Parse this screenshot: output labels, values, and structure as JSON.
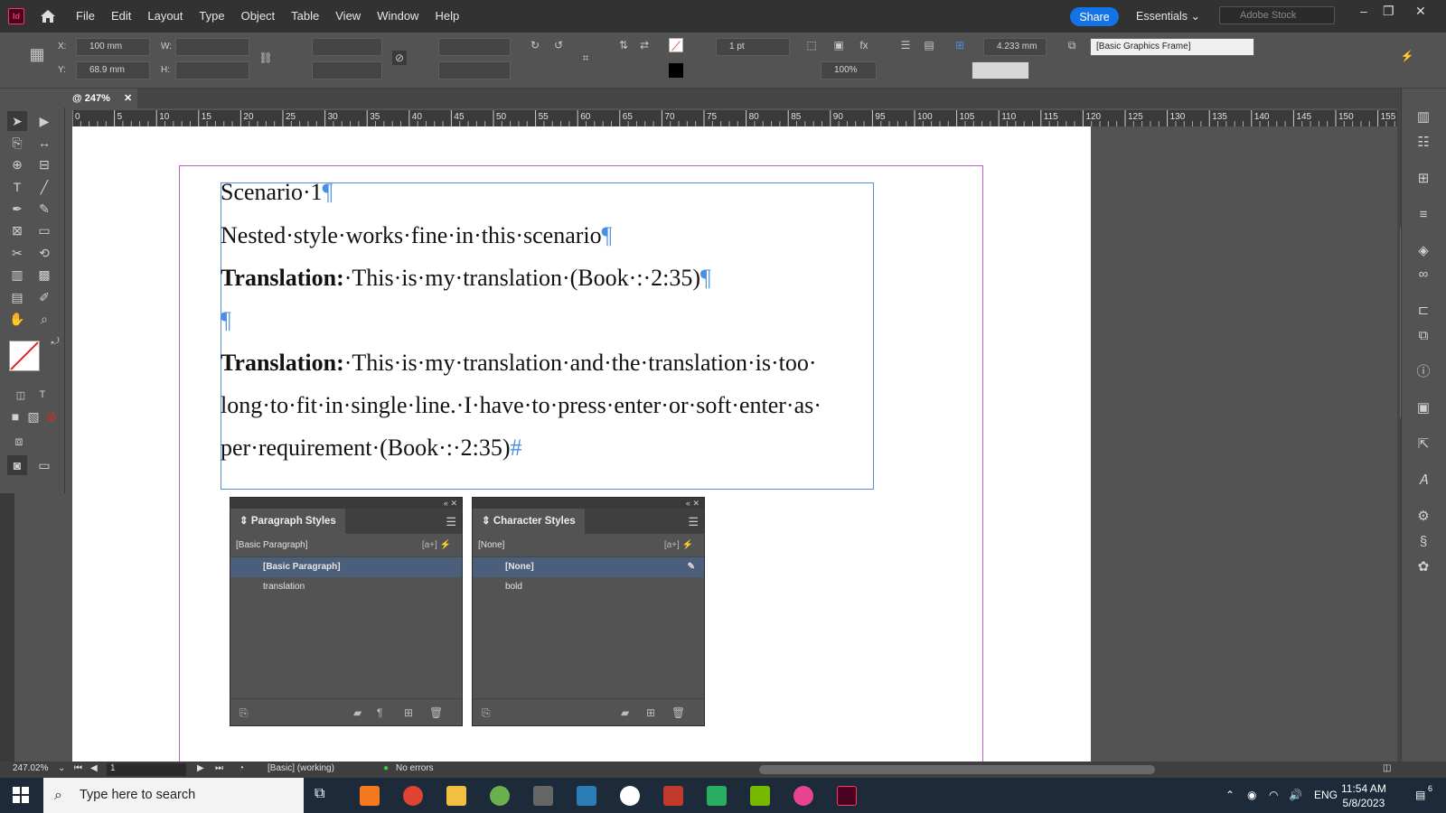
{
  "app": {
    "logo": "Id"
  },
  "menu": {
    "items": [
      "File",
      "Edit",
      "Layout",
      "Type",
      "Object",
      "Table",
      "View",
      "Window",
      "Help"
    ]
  },
  "topbar": {
    "share": "Share",
    "workspace": "Essentials",
    "stock_placeholder": "Adobe Stock"
  },
  "control": {
    "x_label": "X:",
    "x_value": "100 mm",
    "y_label": "Y:",
    "y_value": "68.9 mm",
    "w_label": "W:",
    "h_label": "H:",
    "stroke_weight": "1 pt",
    "scale": "100%",
    "gap": "4.233 mm",
    "object_style": "[Basic Graphics Frame]"
  },
  "document": {
    "tab": "@ 247%"
  },
  "ruler": {
    "ticks": [
      "0",
      "5",
      "10",
      "15",
      "20",
      "25",
      "30",
      "35",
      "40",
      "45",
      "50",
      "55",
      "60",
      "65",
      "70",
      "75",
      "80",
      "85",
      "90",
      "95",
      "100",
      "105",
      "110",
      "115",
      "120",
      "125",
      "130",
      "135",
      "140",
      "145",
      "150",
      "155"
    ]
  },
  "text_frame": {
    "line1": "Scenario·1",
    "line2": "Nested·style·works·fine·in·this·scenario",
    "line3_bold": "Translation:",
    "line3_rest": "·This·is·my·translation·(Book·:·2:35)",
    "line5_bold": "Translation:",
    "line5_rest": "·This·is·my·translation·and·the·translation·is·too·",
    "line6": "long·to·fit·in·single·line.·I·have·to·press·enter·or·soft·enter·as·",
    "line7": "per·requirement·(Book·:·2:35)",
    "pilcrow": "¶",
    "end_mark": "#"
  },
  "paragraph_panel": {
    "title": "Paragraph Styles",
    "current": "[Basic Paragraph]",
    "items": [
      "[Basic Paragraph]",
      "translation"
    ]
  },
  "character_panel": {
    "title": "Character Styles",
    "current": "[None]",
    "items": [
      "[None]",
      "bold"
    ]
  },
  "status": {
    "zoom": "247.02%",
    "page": "1",
    "preflight_profile": "[Basic] (working)",
    "errors": "No errors"
  },
  "taskbar": {
    "search_placeholder": "Type here to search",
    "lang": "ENG",
    "time": "11:54 AM",
    "date": "5/8/2023",
    "notifications": "6"
  }
}
